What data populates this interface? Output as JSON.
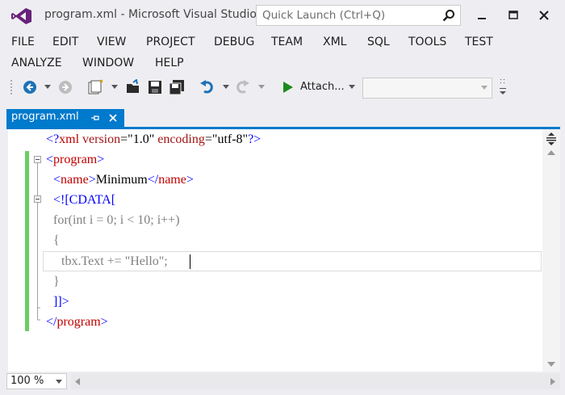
{
  "window": {
    "title": "program.xml - Microsoft Visual Studio"
  },
  "quick_launch": {
    "placeholder": "Quick Launch (Ctrl+Q)"
  },
  "menu": {
    "row1": [
      "FILE",
      "EDIT",
      "VIEW",
      "PROJECT",
      "DEBUG",
      "TEAM",
      "XML",
      "SQL",
      "TOOLS",
      "TEST"
    ],
    "row2": [
      "ANALYZE",
      "WINDOW",
      "HELP"
    ]
  },
  "toolbar": {
    "attach_label": "Attach...",
    "combo_value": ""
  },
  "tab": {
    "label": "program.xml"
  },
  "code": {
    "l1": {
      "a": "<?",
      "b": "xml",
      "c": " version",
      "d": "=",
      "e": "\"1.0\"",
      "f": " encoding",
      "g": "=",
      "h": "\"utf-8\"",
      "i": "?>"
    },
    "l2": {
      "a": "<",
      "b": "program",
      "c": ">"
    },
    "l3": {
      "a": "<",
      "b": "name",
      "c": ">",
      "d": "Minimum",
      "e": "</",
      "f": "name",
      "g": ">"
    },
    "l4": "<![CDATA[",
    "l5": "for(int i = 0; i < 10; i++)",
    "l6": "{",
    "l7": "tbx.Text += \"Hello\";",
    "l8": "}",
    "l9": "]]>",
    "l10": {
      "a": "</",
      "b": "program",
      "c": ">"
    }
  },
  "status": {
    "zoom": "100 %"
  },
  "colors": {
    "accent": "#007acc",
    "xml_delimiter": "#0000ff",
    "xml_name": "#a31515",
    "cdata": "#808080",
    "change_bar": "#6ace60",
    "vs_purple": "#68217a"
  }
}
